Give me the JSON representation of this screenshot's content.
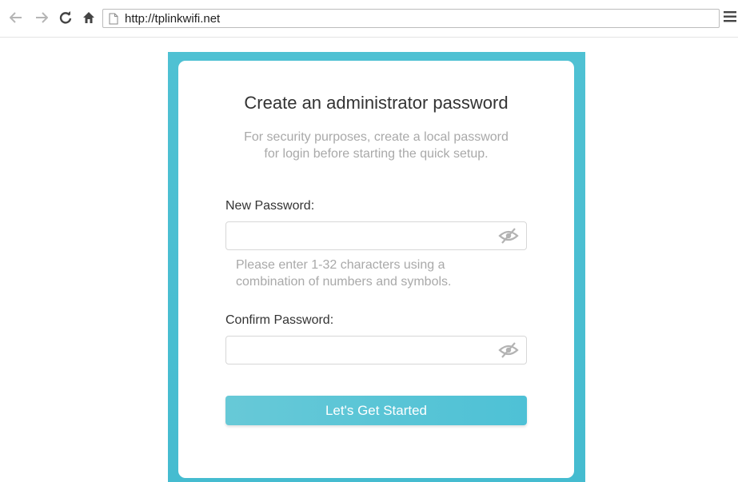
{
  "browser": {
    "url": "http://tplinkwifi.net",
    "back_icon": "arrow-left-icon",
    "forward_icon": "arrow-right-icon",
    "reload_icon": "reload-icon",
    "home_icon": "home-icon",
    "menu_icon": "hamburger-menu-icon"
  },
  "card": {
    "title": "Create an administrator password",
    "subtitle_line1": "For security purposes, create a local password",
    "subtitle_line2": "for login before starting the quick setup.",
    "new_password": {
      "label": "New Password:",
      "value": "",
      "toggle_icon": "eye-hidden-icon"
    },
    "hint_line1": "Please enter 1-32 characters using a",
    "hint_line2": "combination of numbers and symbols.",
    "confirm_password": {
      "label": "Confirm Password:",
      "value": "",
      "toggle_icon": "eye-hidden-icon"
    },
    "button_label": "Let's Get Started"
  },
  "colors": {
    "accent": "#4fc1d3",
    "button": "#5bc5d6",
    "muted_text": "#a9a9a9"
  }
}
